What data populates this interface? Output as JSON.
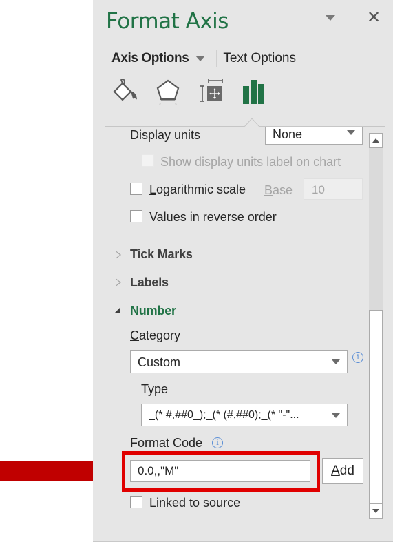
{
  "pane": {
    "title": "Format Axis",
    "menu_icon": "chevron-down-icon",
    "close_icon": "close-icon",
    "close_glyph": "✕"
  },
  "option_tabs": {
    "axis_options": "Axis Options",
    "text_options": "Text Options"
  },
  "icon_tabs": [
    {
      "name": "fill-line",
      "icon": "paint-bucket-icon",
      "active": false
    },
    {
      "name": "effects",
      "icon": "pentagon-icon",
      "active": false
    },
    {
      "name": "size-properties",
      "icon": "size-properties-icon",
      "active": false
    },
    {
      "name": "axis-options",
      "icon": "bar-chart-icon",
      "active": true
    }
  ],
  "display_units": {
    "label_pre": "Display ",
    "label_u": "u",
    "label_post": "nits",
    "value": "None"
  },
  "show_units_label": {
    "u": "S",
    "rest": "how display units label on chart",
    "checked": false,
    "disabled": true
  },
  "log_scale": {
    "u": "L",
    "rest": "ogarithmic scale",
    "checked": false,
    "base_u": "B",
    "base_rest": "ase",
    "base_value": "10"
  },
  "reverse_order": {
    "u": "V",
    "rest": "alues in reverse order",
    "checked": false
  },
  "sections": {
    "tick_marks": "Tick Marks",
    "labels": "Labels",
    "number": "Number"
  },
  "number": {
    "category_u": "C",
    "category_rest": "ategory",
    "category_value": "Custom",
    "type_label": "Type",
    "type_value": "_(* #,##0_);_(* (#,##0);_(* \"-\"...",
    "format_code_pre": "Forma",
    "format_code_u": "t",
    "format_code_post": " Code",
    "format_code_value": "0.0,,\"M\"",
    "add_u": "A",
    "add_rest": "dd",
    "linked_pre": "L",
    "linked_u": "i",
    "linked_post": "nked to source",
    "linked_checked": false,
    "info_glyph": "i"
  },
  "annotation": {
    "arrow_color": "#c00000",
    "highlight_color": "#e00000"
  },
  "colors": {
    "accent": "#217346",
    "panel_bg": "#e6e6e6"
  }
}
